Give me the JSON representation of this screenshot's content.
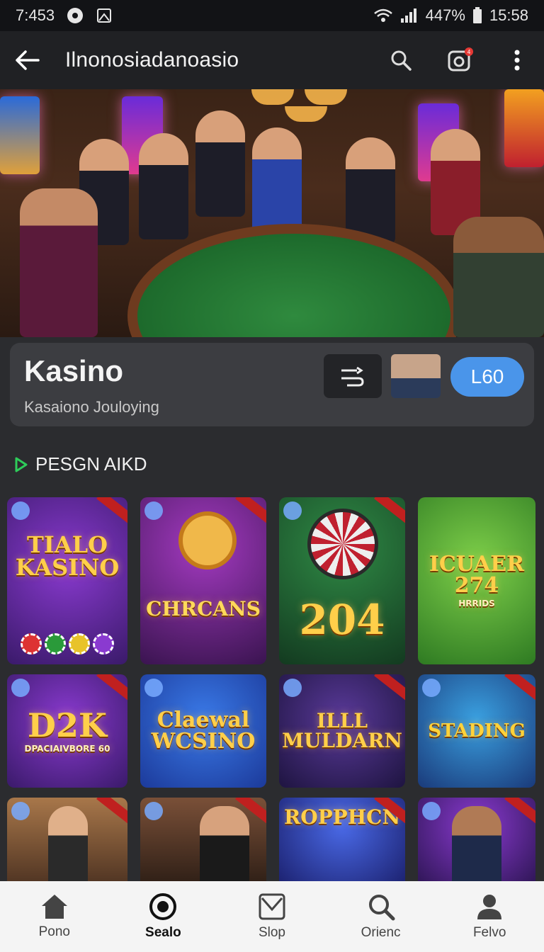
{
  "status_bar": {
    "time": "7:453",
    "battery": "447%",
    "clock": "15:58"
  },
  "app_bar": {
    "title": "Ilnonosiadanoasio",
    "notification_count": "4"
  },
  "info_card": {
    "title": "Kasino",
    "subtitle": "Kasaiono Jouloying",
    "level": "L60"
  },
  "section": {
    "title": "PESGN AIKD"
  },
  "tiles": [
    {
      "title": "TIALO KASINO",
      "sub": "",
      "bg": "#5b2a8f"
    },
    {
      "title": "CHRCANS",
      "sub": "",
      "bg": "#6a2a78"
    },
    {
      "title": "204",
      "sub": "",
      "bg": "#1f6a35"
    },
    {
      "title": "ICUAER 274",
      "sub": "HRRIDS",
      "bg": "#3f8f2b"
    },
    {
      "title": "D2K",
      "sub": "DPACIAIVBORE 60",
      "bg": "#5a2a8a"
    },
    {
      "title": "Claewal WCSINO",
      "sub": "",
      "bg": "#2c58c9"
    },
    {
      "title": "ILLL MULDARN",
      "sub": "",
      "bg": "#3d2a6a"
    },
    {
      "title": "STADING",
      "sub": "",
      "bg": "#2e7fb8"
    },
    {
      "title": "",
      "sub": "",
      "bg": "#8a5a3c"
    },
    {
      "title": "",
      "sub": "",
      "bg": "#5a4032"
    },
    {
      "title": "ROPPHCN",
      "sub": "",
      "bg": "#2b3aa8"
    },
    {
      "title": "",
      "sub": "",
      "bg": "#5a2aa0"
    }
  ],
  "bottom_nav": [
    {
      "label": "Pono",
      "icon": "home-icon"
    },
    {
      "label": "Sealo",
      "icon": "record-icon",
      "active": true
    },
    {
      "label": "Slop",
      "icon": "mail-icon"
    },
    {
      "label": "Orienc",
      "icon": "search-icon"
    },
    {
      "label": "Felvo",
      "icon": "person-icon"
    }
  ]
}
